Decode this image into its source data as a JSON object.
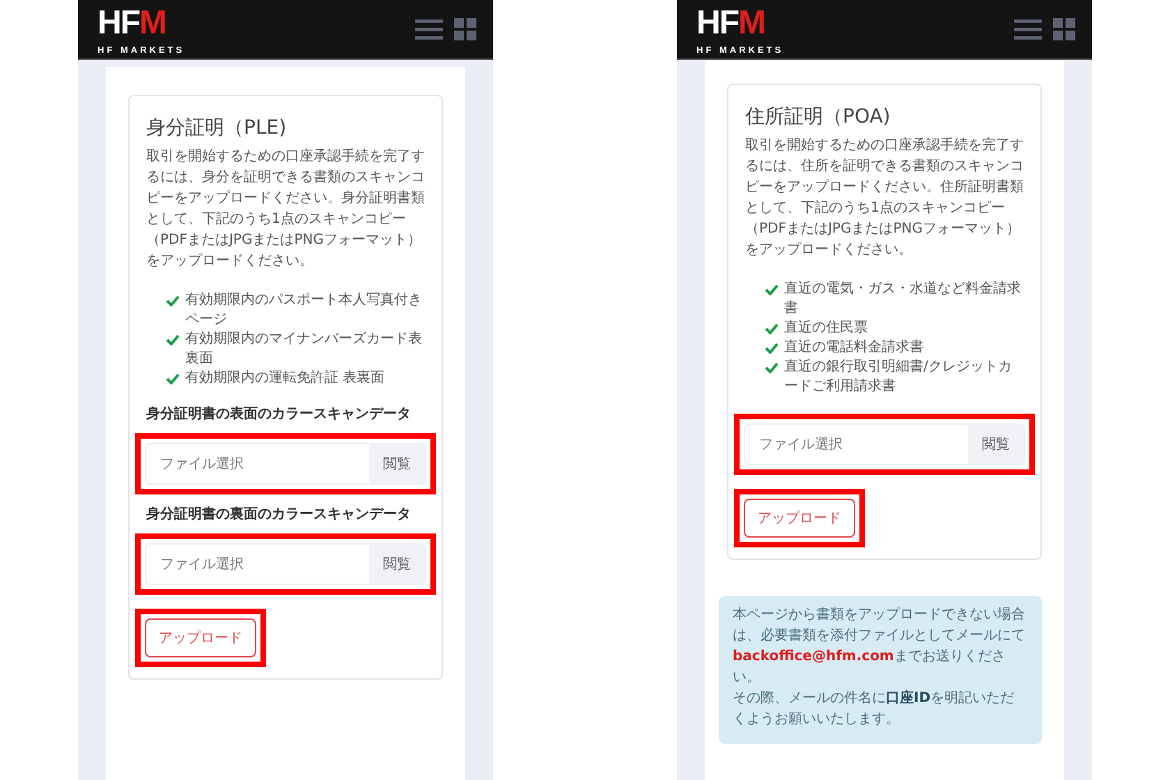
{
  "phones": [
    {
      "logo": {
        "mark": "HFM",
        "name": "HF MARKETS"
      },
      "cards": [
        {
          "title": "身分証明（PLE)",
          "description": "取引を開始するための口座承認手続を完了するには、身分を証明できる書類のスキャンコピーをアップロードください。身分証明書類として、下記のうち1点のスキャンコピー（PDFまたはJPGまたはPNGフォーマット）をアップロードください。",
          "documents": [
            "有効期限内のパスポート本人写真付きページ",
            "有効期限内のマイナンバーズカード表裏面",
            "有効期限内の運転免許証 表裏面"
          ],
          "uploads": [
            {
              "label": "身分証明書の表面のカラースキャンデータ",
              "placeholder": "ファイル選択",
              "browse": "閲覧",
              "highlighted": true
            },
            {
              "label": "身分証明書の裏面のカラースキャンデータ",
              "placeholder": "ファイル選択",
              "browse": "閲覧",
              "highlighted": true
            }
          ],
          "upload_button": {
            "label": "アップロード",
            "highlighted": true
          }
        }
      ]
    },
    {
      "logo": {
        "mark": "HFM",
        "name": "HF MARKETS"
      },
      "cards": [
        {
          "title": "住所証明（POA)",
          "description": "取引を開始するための口座承認手続を完了するには、住所を証明できる書類のスキャンコピーをアップロードください。住所証明書類として、下記のうち1点のスキャンコピー（PDFまたはJPGまたはPNGフォーマット）をアップロードください。",
          "documents": [
            "直近の電気・ガス・水道など料金請求書",
            "直近の住民票",
            "直近の電話料金請求書",
            "直近の銀行取引明細書/クレジットカードご利用請求書"
          ],
          "uploads": [
            {
              "placeholder": "ファイル選択",
              "browse": "閲覧",
              "highlighted": true
            }
          ],
          "upload_button": {
            "label": "アップロード",
            "highlighted": true
          }
        }
      ],
      "notice": {
        "before": "本ページから書類をアップロードできない場合は、必要書類を添付ファイルとしてメールにて",
        "email": "backoffice@hfm.com",
        "after": "までお送りください。",
        "note": "その際、メールの件名に**口座ID**を明記いただくようお願いいたします。"
      }
    }
  ]
}
